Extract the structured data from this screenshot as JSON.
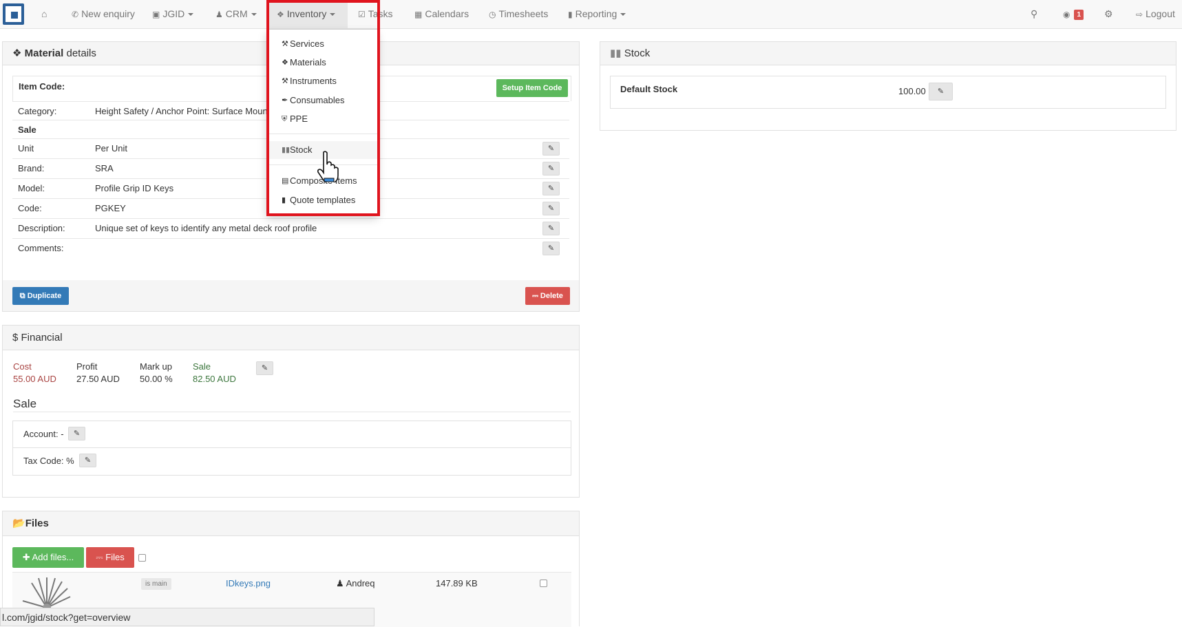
{
  "nav": {
    "new_enquiry": "New enquiry",
    "jgid": "JGID",
    "crm": "CRM",
    "inventory": "Inventory",
    "tasks": "Tasks",
    "calendars": "Calendars",
    "timesheets": "Timesheets",
    "reporting": "Reporting",
    "notif_count": "1",
    "logout": "Logout"
  },
  "dropdown": {
    "items": [
      "Services",
      "Materials",
      "Instruments",
      "Consumables",
      "PPE",
      "Stock",
      "Composite Items",
      "Quote templates"
    ]
  },
  "material": {
    "title_bold": "Material",
    "title_rest": "details",
    "item_code_label": "Item Code:",
    "setup_btn": "Setup Item Code",
    "category_label": "Category:",
    "category_value": "Height Safety / Anchor Point: Surface Mount",
    "sale_heading": "Sale",
    "unit_label": "Unit",
    "unit_value": "Per Unit",
    "brand_label": "Brand:",
    "brand_value": "SRA",
    "model_label": "Model:",
    "model_value": "Profile Grip ID Keys",
    "code_label": "Code:",
    "code_value": "PGKEY",
    "desc_label": "Description:",
    "desc_value": "Unique set of keys to identify any metal deck roof profile",
    "comments_label": "Comments:",
    "duplicate_btn": "Duplicate",
    "delete_btn": "Delete"
  },
  "financial": {
    "title": "Financial",
    "cost_label": "Cost",
    "cost_value": "55.00 AUD",
    "profit_label": "Profit",
    "profit_value": "27.50 AUD",
    "markup_label": "Mark up",
    "markup_value": "50.00 %",
    "sale_label": "Sale",
    "sale_value": "82.50 AUD",
    "sale_heading": "Sale",
    "account_label": "Account: -",
    "tax_label": "Tax Code: %"
  },
  "files": {
    "title": "Files",
    "add_btn": "Add files...",
    "files_btn": "Files",
    "is_main": "is main",
    "file_name": "IDkeys.png",
    "user": "Andreq",
    "size": "147.89 KB"
  },
  "stock": {
    "title": "Stock",
    "default_label": "Default Stock",
    "default_value": "100.00"
  },
  "statusbar": "l.com/jgid/stock?get=overview",
  "colors": {
    "red_highlight": "#e0141e",
    "green": "#5cb85c",
    "blue": "#337ab7",
    "danger": "#d9534f",
    "cost": "#a94442",
    "sale": "#3c763d"
  }
}
